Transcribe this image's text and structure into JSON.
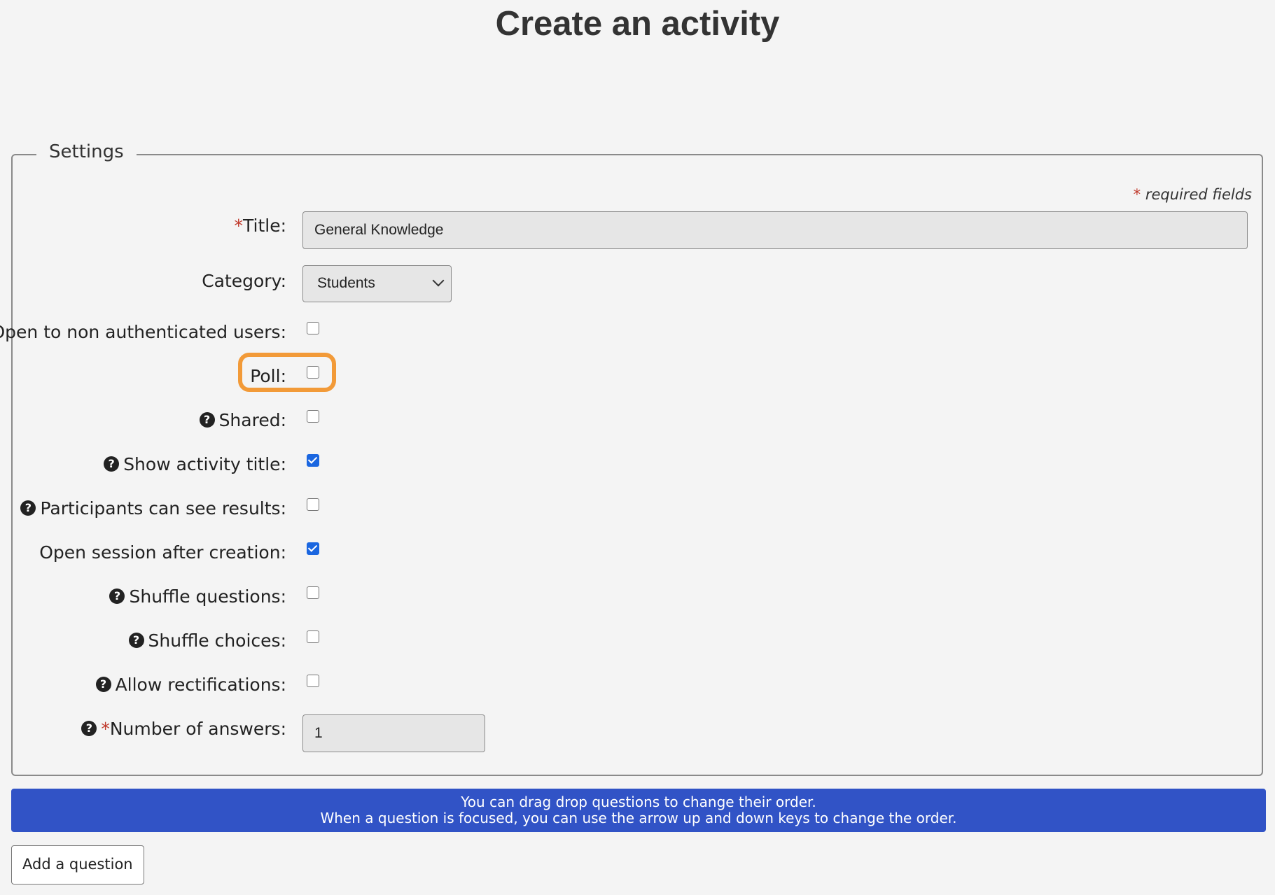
{
  "page": {
    "title": "Create an activity"
  },
  "settings": {
    "legend": "Settings",
    "required_note_star": "*",
    "required_note_text": "required fields",
    "title": {
      "star": "*",
      "label": "Title:",
      "value": "General Knowledge"
    },
    "category": {
      "label": "Category:",
      "selected": "Students"
    },
    "open_non_auth": {
      "label": "Open to non authenticated users:",
      "checked": false
    },
    "poll": {
      "label": "Poll:",
      "checked": false,
      "highlight_color": "#f29a38"
    },
    "shared": {
      "label": "Shared:",
      "checked": false,
      "help": "?"
    },
    "show_title": {
      "label": "Show activity title:",
      "checked": true,
      "help": "?"
    },
    "participants_results": {
      "label": "Participants can see results:",
      "checked": false,
      "help": "?"
    },
    "open_session": {
      "label": "Open session after creation:",
      "checked": true
    },
    "shuffle_questions": {
      "label": "Shuffle questions:",
      "checked": false,
      "help": "?"
    },
    "shuffle_choices": {
      "label": "Shuffle choices:",
      "checked": false,
      "help": "?"
    },
    "allow_rectifications": {
      "label": "Allow rectifications:",
      "checked": false,
      "help": "?"
    },
    "num_answers": {
      "star": "*",
      "label": "Number of answers:",
      "value": "1",
      "help": "?"
    }
  },
  "banner": {
    "line1": "You can drag drop questions to change their order.",
    "line2": "When a question is focused, you can use the arrow up and down keys to change the order.",
    "color": "#3153c6"
  },
  "actions": {
    "add_question": "Add a question"
  },
  "icons": {
    "help": "question-circle-icon",
    "dropdown": "chevron-down-icon"
  }
}
